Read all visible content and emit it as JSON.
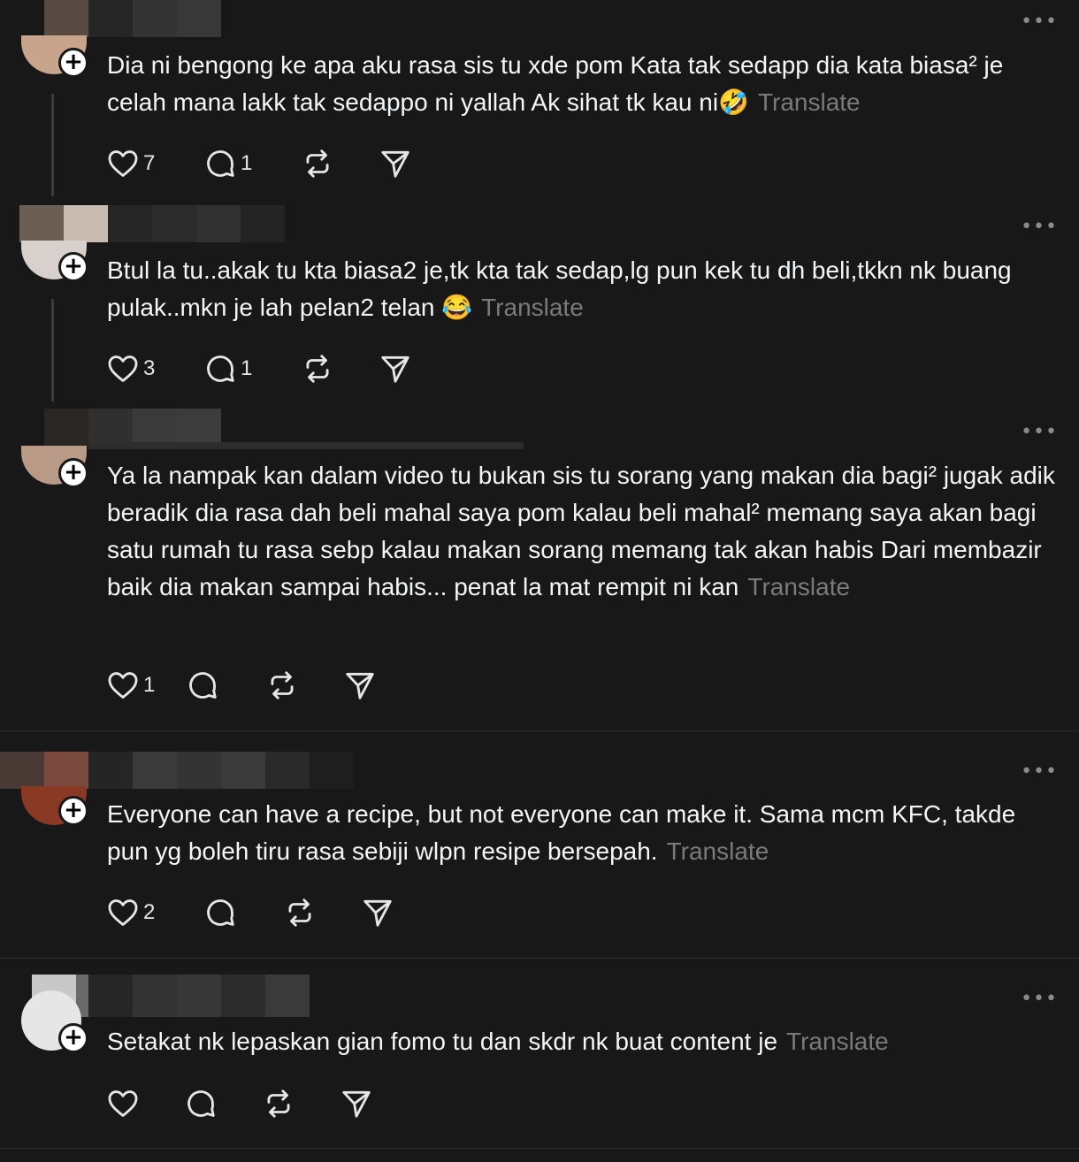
{
  "translate_label": "Translate",
  "more_label": "•••",
  "plus_label": "+",
  "posts": [
    {
      "text": "Dia ni bengong ke apa aku rasa sis tu xde pom Kata tak sedapp dia kata biasa² je celah mana lakk tak sedappo ni yallah Ak sihat tk kau ni🤣",
      "likes": "7",
      "replies": "1"
    },
    {
      "text": "Btul la tu..akak tu kta biasa2 je,tk kta tak sedap,lg pun kek tu dh beli,tkkn nk buang pulak..mkn je lah pelan2 telan 😂",
      "likes": "3",
      "replies": "1"
    },
    {
      "text": "Ya la nampak kan dalam video tu bukan sis tu sorang yang makan dia bagi² jugak adik beradik dia rasa dah beli mahal saya pom kalau beli mahal² memang saya akan bagi satu rumah tu rasa sebp kalau makan sorang memang tak akan habis Dari membazir baik dia makan sampai habis... penat la mat rempit ni kan",
      "likes": "1",
      "replies": ""
    },
    {
      "text": "Everyone can have a recipe, but not everyone can make it. Sama mcm KFC, takde pun yg boleh tiru rasa sebiji wlpn resipe bersepah.",
      "likes": "2",
      "replies": ""
    },
    {
      "text": "Setakat nk lepaskan gian fomo tu dan skdr nk buat content je",
      "likes": "",
      "replies": ""
    }
  ],
  "colors": {
    "background": "#181818",
    "text": "#f3f5f7",
    "muted": "#7a7a7a",
    "divider": "#2e2e2e"
  },
  "icons": [
    "heart-icon",
    "comment-icon",
    "repost-icon",
    "share-icon",
    "plus-icon",
    "more-icon"
  ]
}
